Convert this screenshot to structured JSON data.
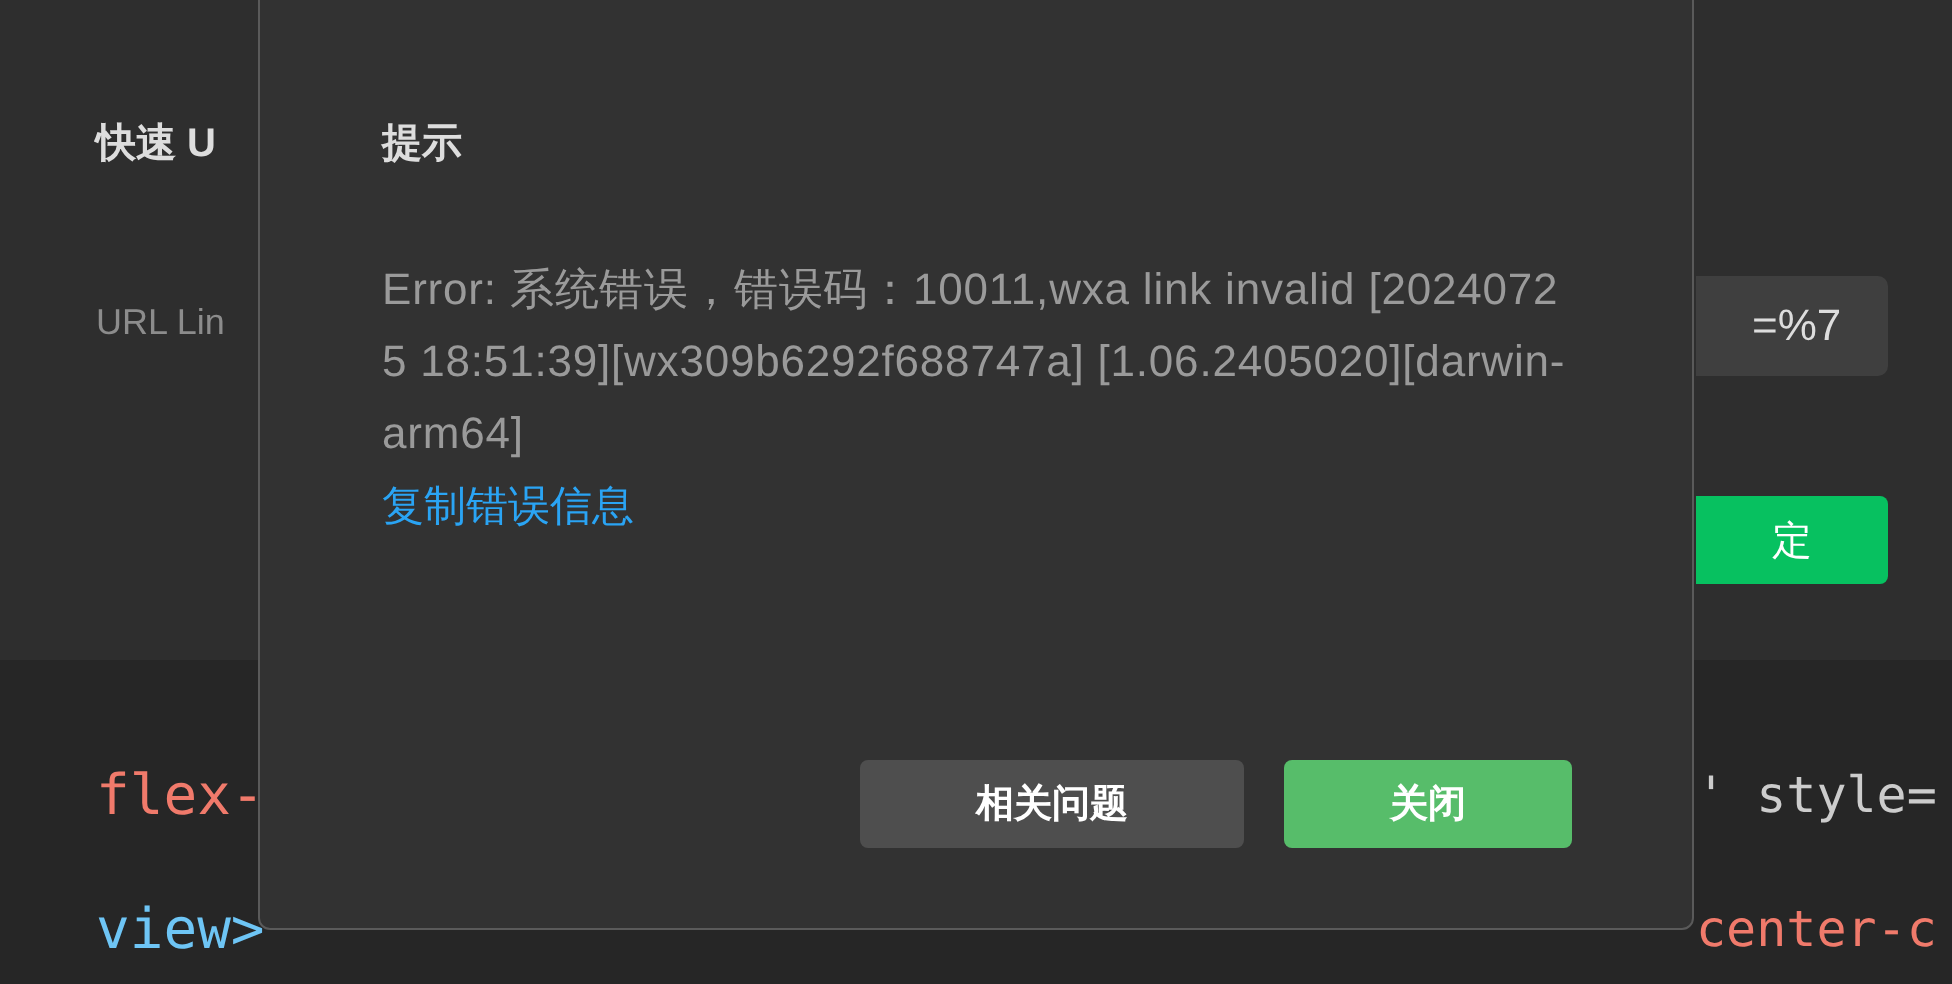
{
  "background_panel": {
    "title": "快速 U",
    "field_label": "URL Lin",
    "field_value": "=%7",
    "confirm_button": "定"
  },
  "code_lines": [
    {
      "left": "flex-",
      "right": "' style="
    },
    {
      "left": "view>",
      "right": "center-c"
    }
  ],
  "dialog": {
    "title": "提示",
    "message": "Error: 系统错误，错误码：10011,wxa link invalid [20240725 18:51:39][wx309b6292f688747a] [1.06.2405020][darwin-arm64]",
    "link": "复制错误信息",
    "buttons": [
      {
        "label": "相关问题",
        "kind": "secondary"
      },
      {
        "label": "关闭",
        "kind": "primary"
      }
    ]
  }
}
